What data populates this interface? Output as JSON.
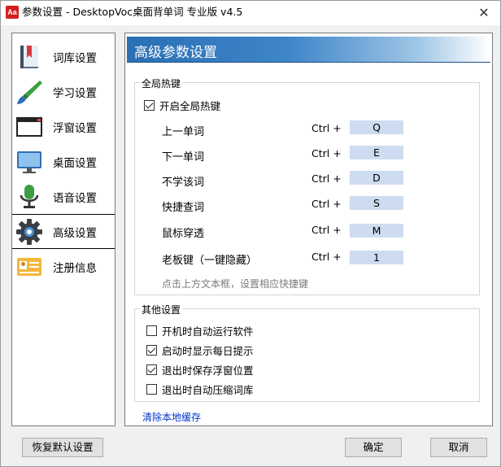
{
  "window": {
    "app_icon_text": "Aa",
    "title": "参数设置 - DesktopVoc桌面背单词 专业版 v4.5",
    "close_glyph": "✕"
  },
  "sidebar": {
    "items": [
      {
        "label": "词库设置",
        "icon": "book-icon"
      },
      {
        "label": "学习设置",
        "icon": "brush-icon"
      },
      {
        "label": "浮窗设置",
        "icon": "window-icon"
      },
      {
        "label": "桌面设置",
        "icon": "monitor-icon"
      },
      {
        "label": "语音设置",
        "icon": "microphone-icon"
      },
      {
        "label": "高级设置",
        "icon": "gear-icon",
        "active": true
      },
      {
        "label": "注册信息",
        "icon": "id-card-icon"
      }
    ]
  },
  "content": {
    "header_title": "高级参数设置",
    "hotkeys_group": {
      "legend": "全局热键",
      "enable_label": "开启全局热键",
      "enable_checked": true,
      "rows": [
        {
          "label": "上一单词",
          "modifier": "Ctrl +",
          "key": "Q"
        },
        {
          "label": "下一单词",
          "modifier": "Ctrl +",
          "key": "E"
        },
        {
          "label": "不学该词",
          "modifier": "Ctrl +",
          "key": "D"
        },
        {
          "label": "快捷查词",
          "modifier": "Ctrl +",
          "key": "S"
        },
        {
          "label": "鼠标穿透",
          "modifier": "Ctrl +",
          "key": "M"
        },
        {
          "label": "老板键（一键隐藏）",
          "modifier": "Ctrl +",
          "key": "1"
        }
      ],
      "hint": "点击上方文本框，设置相应快捷键"
    },
    "other_group": {
      "legend": "其他设置",
      "options": [
        {
          "label": "开机时自动运行软件",
          "checked": false
        },
        {
          "label": "启动时显示每日提示",
          "checked": true
        },
        {
          "label": "退出时保存浮窗位置",
          "checked": true
        },
        {
          "label": "退出时自动压缩词库",
          "checked": false
        }
      ]
    },
    "clear_cache_link": "清除本地缓存"
  },
  "buttons": {
    "restore_defaults": "恢复默认设置",
    "ok": "确定",
    "cancel": "取消"
  },
  "colors": {
    "header_gradient_start": "#2a6fb4",
    "hotkey_box": "#cddcf0",
    "link": "#0033cc"
  }
}
